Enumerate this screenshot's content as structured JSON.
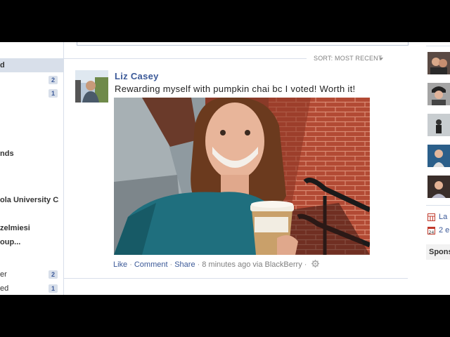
{
  "sidebar": {
    "items": [
      {
        "label": "d",
        "count": "",
        "selected": true,
        "bold": true
      },
      {
        "label": "",
        "count": "2"
      },
      {
        "label": "",
        "count": "1"
      },
      {
        "label": "nds",
        "count": "",
        "bold": true
      },
      {
        "label": "ola University C...",
        "count": "",
        "bold": true
      },
      {
        "label": "zelmiesi",
        "count": "",
        "bold": true
      },
      {
        "label": "oup...",
        "count": "",
        "bold": true
      },
      {
        "label": "er",
        "count": "2"
      },
      {
        "label": "ed",
        "count": "1"
      }
    ]
  },
  "feed": {
    "sort_label": "SORT: MOST RECENT",
    "story": {
      "author": "Liz Casey",
      "status": "Rewarding myself with pumpkin chai bc I voted! Worth it!",
      "actions": {
        "like": "Like",
        "comment": "Comment",
        "share": "Share",
        "separator": "·",
        "meta": "8 minutes ago via BlackBerry"
      }
    }
  },
  "right_column": {
    "links": [
      {
        "text": "La",
        "icon": "calendar-grid-icon"
      },
      {
        "text": "2 e",
        "icon": "calendar-date-icon"
      }
    ],
    "sponsored": "Spons"
  },
  "colors": {
    "link_blue": "#3b5998",
    "divider": "#d8dfea",
    "meta_gray": "#808080"
  }
}
